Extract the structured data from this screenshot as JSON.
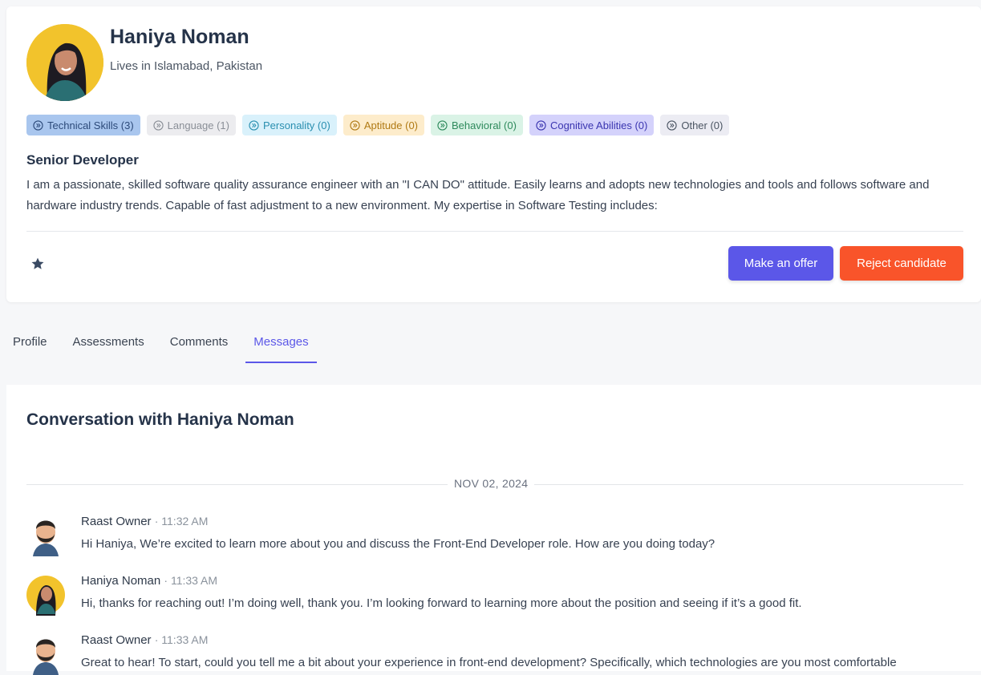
{
  "candidate": {
    "name": "Haniya Noman",
    "location": "Lives in Islamabad, Pakistan",
    "title": "Senior Developer",
    "summary": "I am a passionate, skilled software quality assurance engineer with an \"I CAN DO\" attitude. Easily learns and adopts new technologies and tools and follows software and hardware industry trends. Capable of fast adjustment to a new environment. My expertise in Software Testing includes:"
  },
  "tags": [
    {
      "label": "Technical Skills (3)",
      "bg": "#a9c6ee",
      "fg": "#2c4a7a"
    },
    {
      "label": "Language (1)",
      "bg": "#ececef",
      "fg": "#8a8f97"
    },
    {
      "label": "Personality (0)",
      "bg": "#d9f1fb",
      "fg": "#2a8fb0"
    },
    {
      "label": "Aptitude (0)",
      "bg": "#fdeccb",
      "fg": "#b07a14"
    },
    {
      "label": "Behavioral (0)",
      "bg": "#daf3e6",
      "fg": "#2e8a5c"
    },
    {
      "label": "Cognitive Abilities (0)",
      "bg": "#d4d2fb",
      "fg": "#3a35b0"
    },
    {
      "label": "Other (0)",
      "bg": "#ececf3",
      "fg": "#4b5563"
    }
  ],
  "actions": {
    "offer_label": "Make an offer",
    "reject_label": "Reject candidate"
  },
  "tabs": [
    {
      "label": "Profile",
      "active": false
    },
    {
      "label": "Assessments",
      "active": false
    },
    {
      "label": "Comments",
      "active": false
    },
    {
      "label": "Messages",
      "active": true
    }
  ],
  "conversation": {
    "title": "Conversation with Haniya Noman",
    "date": "NOV 02, 2024",
    "messages": [
      {
        "author": "Raast Owner",
        "time": "· 11:32 AM",
        "text": "Hi Haniya, We’re excited to learn more about you and discuss the Front-End Developer role. How are you doing today?"
      },
      {
        "author": "Haniya Noman",
        "time": "· 11:33 AM",
        "text": "Hi, thanks for reaching out! I’m doing well, thank you. I’m looking forward to learning more about the position and seeing if it’s a good fit."
      },
      {
        "author": "Raast Owner",
        "time": "· 11:33 AM",
        "text": "Great to hear! To start, could you tell me a bit about your experience in front-end development? Specifically, which technologies are you most comfortable"
      }
    ]
  },
  "colors": {
    "accent": "#5b57e8",
    "danger": "#f9542a"
  }
}
